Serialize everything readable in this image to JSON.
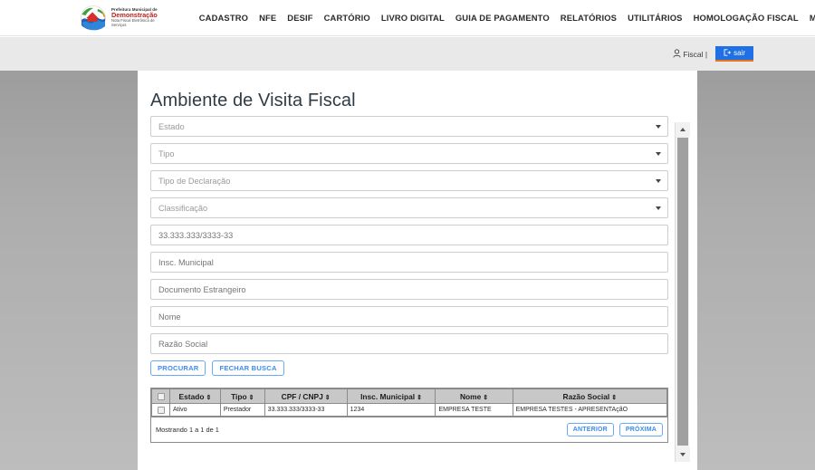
{
  "brand": {
    "line1": "Prefeitura Municipal de",
    "line2": "Demonstração",
    "line3": "Nota Fiscal Eletrônica de Serviços"
  },
  "nav": {
    "items": [
      {
        "label": "CADASTRO"
      },
      {
        "label": "NFE"
      },
      {
        "label": "DESIF"
      },
      {
        "label": "CARTÓRIO"
      },
      {
        "label": "LIVRO DIGITAL"
      },
      {
        "label": "GUIA DE PAGAMENTO"
      },
      {
        "label": "RELATÓRIOS"
      },
      {
        "label": "UTILITÁRIOS"
      },
      {
        "label": "HOMOLOGAÇÃO FISCAL"
      },
      {
        "label": "MANUAIS"
      }
    ]
  },
  "userbar": {
    "user_label": "Fiscal |",
    "logout_label": "sair",
    "person_icon": "user-icon",
    "logout_icon": "logout-icon"
  },
  "page": {
    "title": "Ambiente de Visita Fiscal"
  },
  "form": {
    "selects": [
      {
        "placeholder": "Estado"
      },
      {
        "placeholder": "Tipo"
      },
      {
        "placeholder": "Tipo de Declaração"
      },
      {
        "placeholder": "Classificação"
      }
    ],
    "inputs": [
      {
        "placeholder": "33.333.333/3333-33",
        "value": ""
      },
      {
        "placeholder": "Insc. Municipal",
        "value": ""
      },
      {
        "placeholder": "Documento Estrangeiro",
        "value": ""
      },
      {
        "placeholder": "Nome",
        "value": ""
      },
      {
        "placeholder": "Razão Social",
        "value": ""
      }
    ],
    "buttons": {
      "search": "PROCURAR",
      "close": "FECHAR BUSCA"
    }
  },
  "table": {
    "columns": [
      {
        "label": "",
        "sortable": false
      },
      {
        "label": "Estado",
        "sortable": true
      },
      {
        "label": "Tipo",
        "sortable": true
      },
      {
        "label": "CPF / CNPJ",
        "sortable": true
      },
      {
        "label": "Insc. Municipal",
        "sortable": true
      },
      {
        "label": "Nome",
        "sortable": true
      },
      {
        "label": "Razão Social",
        "sortable": true
      }
    ],
    "rows": [
      {
        "estado": "Ativo",
        "tipo": "Prestador",
        "cpf_cnpj": "33.333.333/3333-33",
        "insc_municipal": "1234",
        "nome": "EMPRESA TESTE",
        "razao_social": "EMPRESA TESTES - APRESENTAçãO"
      }
    ],
    "sort_glyph": "⇕"
  },
  "pagination": {
    "showing": "Mostrando 1 a 1 de 1",
    "prev": "ANTERIOR",
    "next": "PRÓXIMA"
  },
  "colors": {
    "brand_red": "#c3201a",
    "accent_blue": "#1f6fe5",
    "link_blue": "#3b8bf0",
    "logout_underline": "#e8751a",
    "table_header": "#c8c8c8"
  }
}
